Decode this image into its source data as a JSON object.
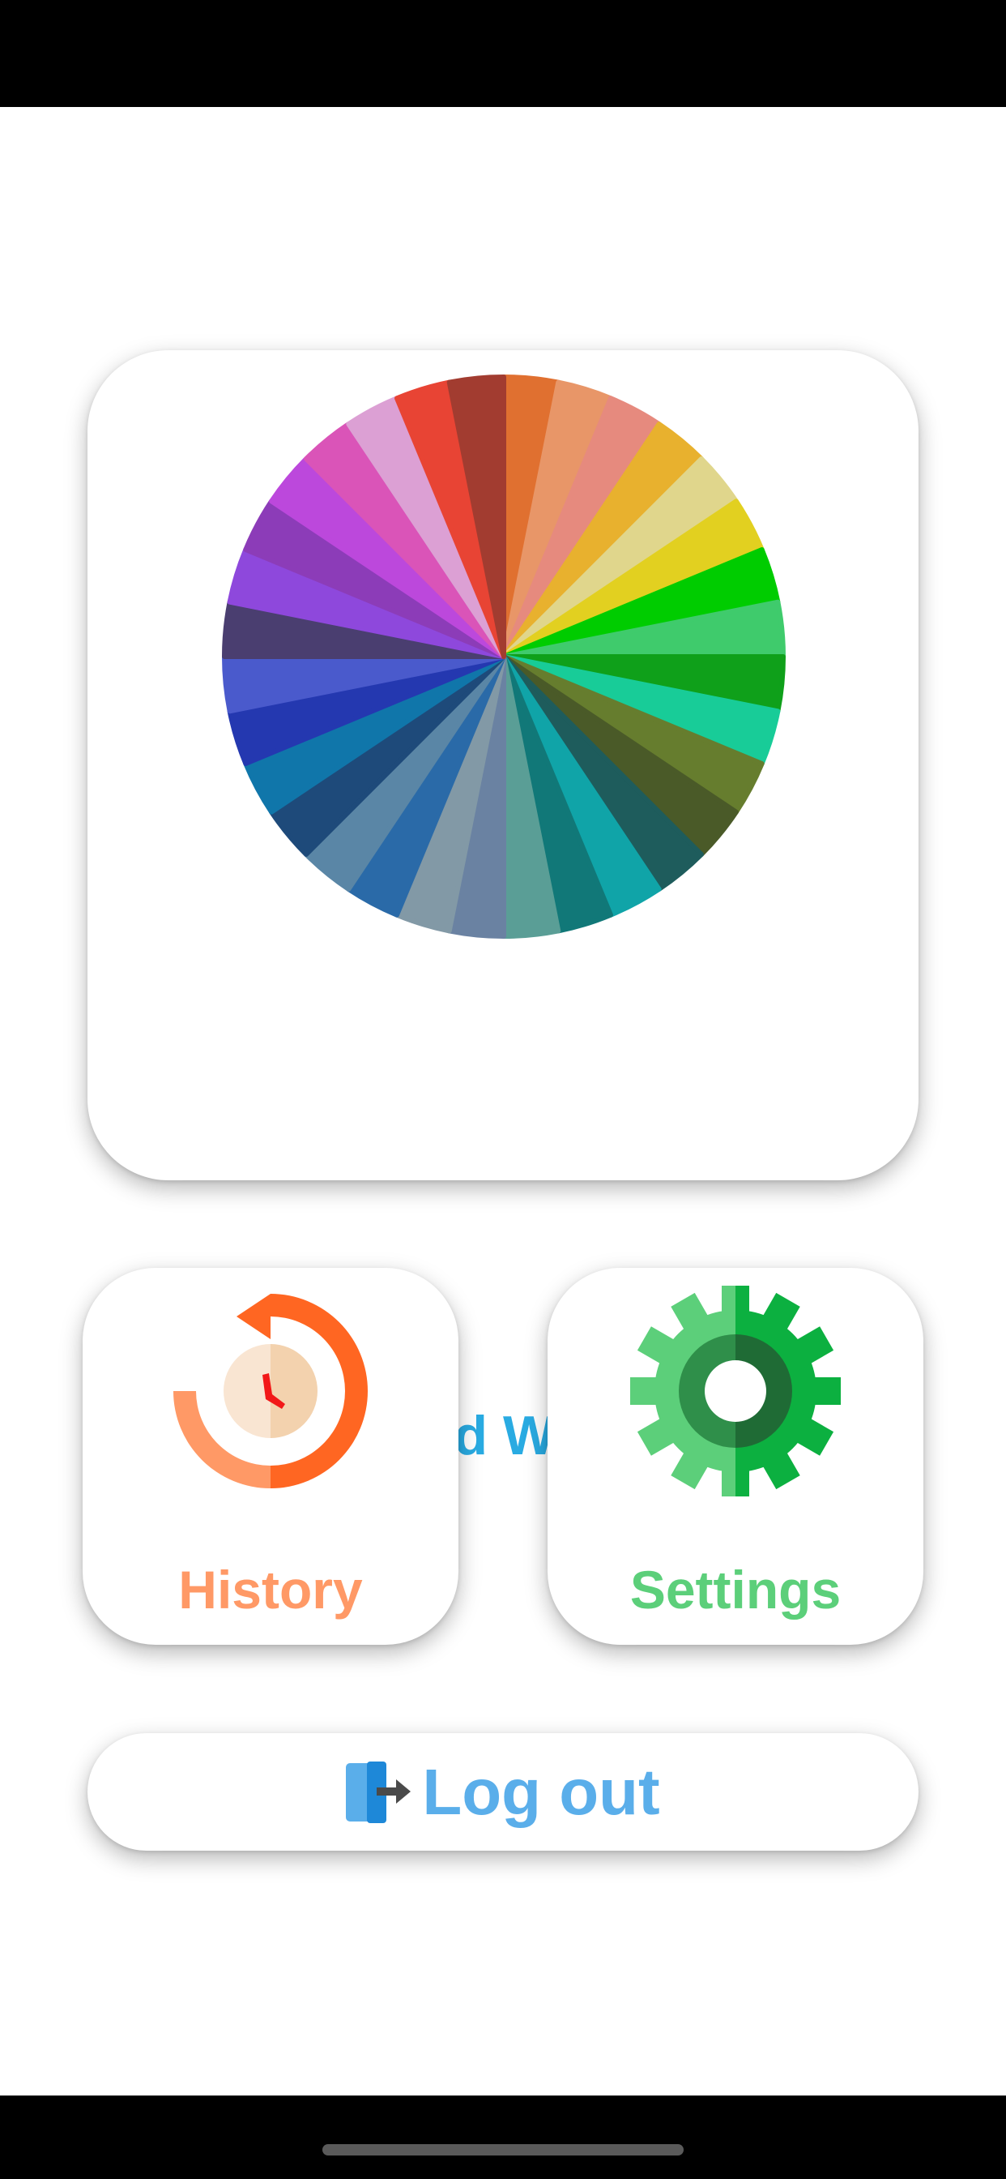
{
  "mood_wheel": {
    "label": "Mood Wheel",
    "color": "#29ABE2"
  },
  "history": {
    "label": "History",
    "color": "#FF9966"
  },
  "settings": {
    "label": "Settings",
    "color": "#5CCF7A"
  },
  "logout": {
    "label": "Log out",
    "color": "#5AAEEA"
  },
  "wheel_colors": [
    "#E07030",
    "#E89668",
    "#E68A7E",
    "#E8B12E",
    "#E0D68C",
    "#E2D020",
    "#00CC00",
    "#3FCB6C",
    "#0FA01A",
    "#18CC98",
    "#667D2E",
    "#4A5A28",
    "#1E5C5C",
    "#10A4A8",
    "#117878",
    "#5A9E96",
    "#6A82A2",
    "#8299A6",
    "#2A6AA8",
    "#5A86A6",
    "#1E4A7A",
    "#1076AA",
    "#2438B0",
    "#4A5ACC",
    "#4A3E70",
    "#8E48DC",
    "#8C3CB8",
    "#BC48DC",
    "#DA54B8",
    "#DCA0D4",
    "#E84434",
    "#A23C30"
  ],
  "icons": {
    "mood": "color-wheel-icon",
    "history": "history-clock-icon",
    "settings": "gear-icon",
    "logout": "logout-door-icon"
  }
}
